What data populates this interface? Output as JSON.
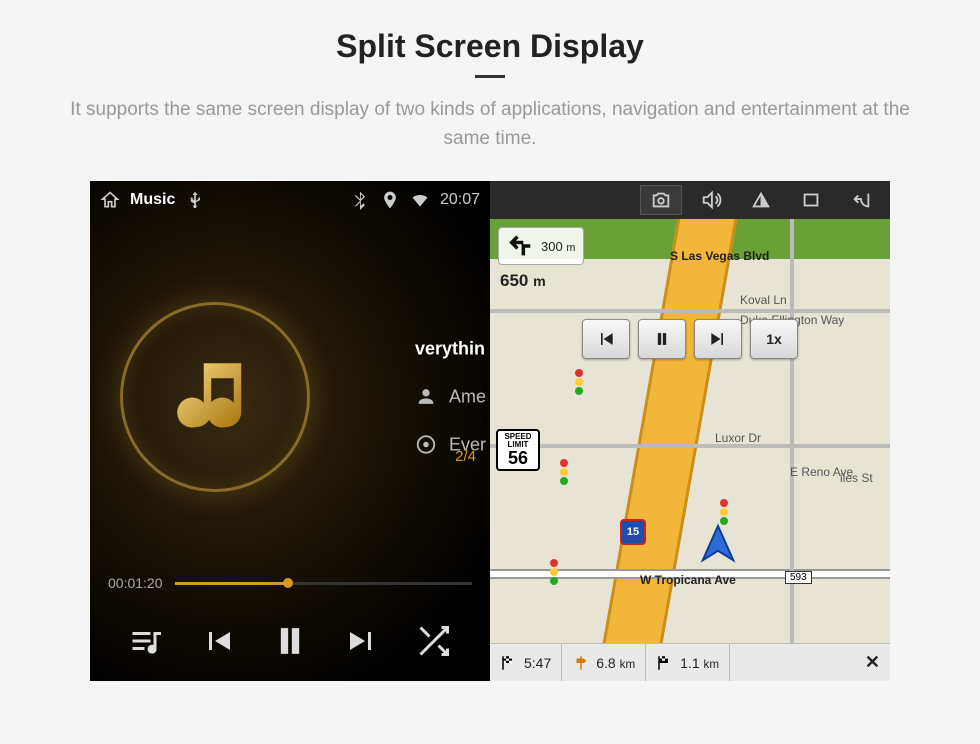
{
  "marketing": {
    "title": "Split Screen Display",
    "subtitle": "It supports the same screen display of two kinds of applications, navigation and entertainment at the same time."
  },
  "status_bar": {
    "title": "Music",
    "clock": "20:07"
  },
  "music": {
    "tracks": {
      "0": {
        "label": "verythin"
      },
      "1": {
        "label": "Ame"
      },
      "2": {
        "label": "Ever"
      }
    },
    "elapsed": "00:01:20",
    "track_counter": "2/4",
    "progress_percent": 38
  },
  "nav": {
    "turn": {
      "distance": "300",
      "unit": "m"
    },
    "next_distance": "650",
    "next_unit": "m",
    "speed_limit": {
      "label_top": "SPEED",
      "label_mid": "LIMIT",
      "value": "56"
    },
    "playback": {
      "speed_label": "1x"
    },
    "streets": {
      "top": "S Las Vegas Blvd",
      "koval": "Koval Ln",
      "duke": "Duke Ellington Way",
      "luxor": "Luxor Dr",
      "reno": "E Reno Ave",
      "tropicana": "W Tropicana Ave",
      "giles": "iles St"
    },
    "tropicana_exit": "593",
    "highway_shield": "15",
    "bottom": {
      "eta": "5:47",
      "dist1": "6.8",
      "dist1_unit": "km",
      "dist2": "1.1",
      "dist2_unit": "km",
      "close": "✕"
    }
  }
}
